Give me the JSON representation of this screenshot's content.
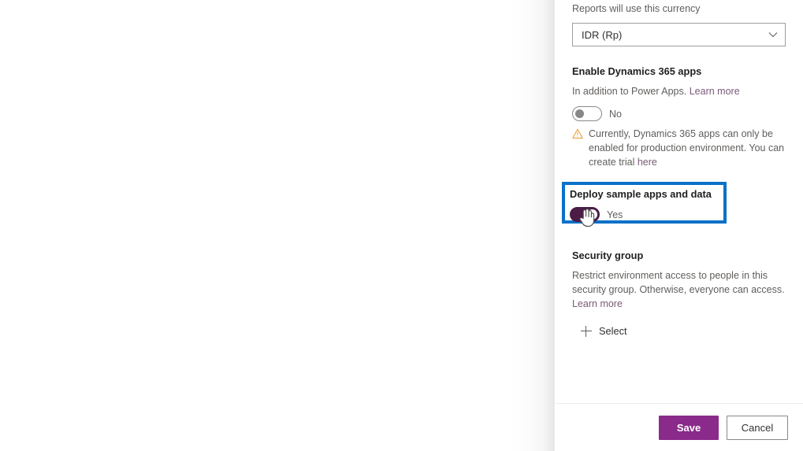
{
  "panel": {
    "currency": {
      "label": "Reports will use this currency",
      "selected": "IDR (Rp)",
      "chevron_icon": "chevron-down-icon"
    },
    "dynamics": {
      "title": "Enable Dynamics 365 apps",
      "description_text": "In addition to Power Apps.",
      "description_link": "Learn more",
      "toggle_state": "No",
      "toggle_on": false,
      "warning_icon": "warning-triangle-icon",
      "warning_text": "Currently, Dynamics 365 apps can only be enabled for production environment. You can create trial",
      "warning_link": "here"
    },
    "sample_apps": {
      "title": "Deploy sample apps and data",
      "toggle_state": "Yes",
      "toggle_on": true,
      "highlighted": true
    },
    "security_group": {
      "title": "Security group",
      "description_text": "Restrict environment access to people in this security group. Otherwise, everyone can access.",
      "description_link": "Learn more",
      "select_label": "Select",
      "plus_icon": "plus-icon"
    },
    "footer": {
      "save_label": "Save",
      "cancel_label": "Cancel"
    }
  },
  "cursor": {
    "icon": "hand-pointer-cursor"
  },
  "colors": {
    "accent_purple": "#8a2a8a",
    "toggle_on": "#4b1c46",
    "highlight_blue": "#0a71c8",
    "warning_orange": "#e8a33d",
    "link": "#7a5a78",
    "text_primary": "#201f1e",
    "text_secondary": "#605e5c"
  }
}
